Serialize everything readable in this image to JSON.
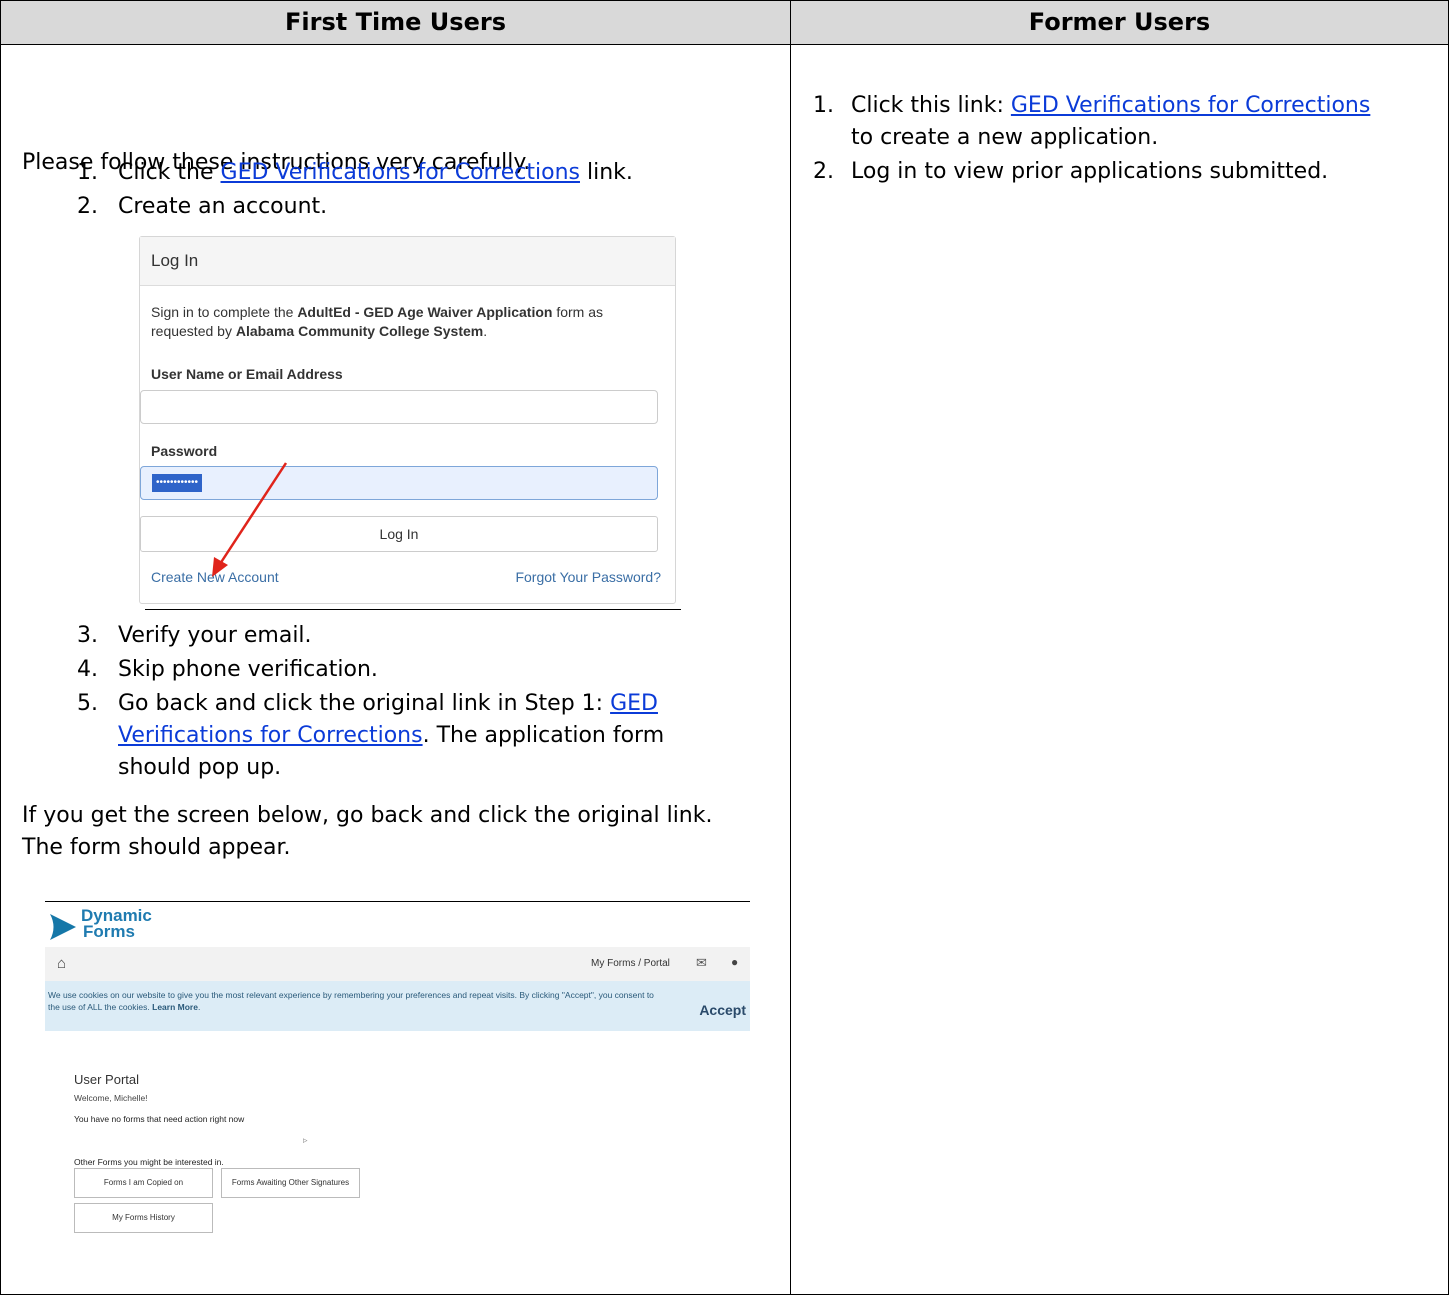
{
  "headers": {
    "left": "First Time Users",
    "right": "Former Users"
  },
  "left": {
    "intro": "Please follow these instructions very carefully.",
    "steps": {
      "s1_num": "1.",
      "s1_pre": "Click the ",
      "s1_link": "GED Verifications for Corrections",
      "s1_post": " link.",
      "s2_num": "2.",
      "s2": "Create an account.",
      "s3_num": "3.",
      "s3": "Verify your email.",
      "s4_num": "4.",
      "s4": "Skip phone verification.",
      "s5_num": "5.",
      "s5_pre": "Go back and click the original link in Step 1: ",
      "s5_link_a": "GED",
      "s5_link_b": "Verifications for Corrections",
      "s5_post_a": ". The application form",
      "s5_post_b": "should pop up."
    },
    "note_line1": "If you get the screen below, go back and click the original link.",
    "note_line2": "The form should appear."
  },
  "login_shot": {
    "title": "Log In",
    "desc_pre": "Sign in to complete the ",
    "desc_bold1": "AdultEd - GED Age Waiver Application",
    "desc_mid": " form as",
    "desc_line2_pre": "requested by ",
    "desc_bold2": "Alabama Community College System",
    "desc_line2_post": ".",
    "user_label": "User Name or Email Address",
    "password_label": "Password",
    "password_value": "••••••••••••",
    "login_button": "Log In",
    "create_account": "Create New Account",
    "forgot_password": "Forgot Your Password?"
  },
  "portal_shot": {
    "logo_line1": "Dynamic",
    "logo_line2": "Forms",
    "nav_link": "My Forms / Portal",
    "cookie_text_1": "We use cookies on our website to give you the most relevant experience by remembering your preferences and repeat visits. By clicking \"Accept\", you consent to",
    "cookie_text_2": "the use of ALL the cookies. ",
    "cookie_learn": "Learn More",
    "cookie_accept": "Accept",
    "portal_title": "User Portal",
    "welcome": "Welcome, Michelle!",
    "no_forms": "You have no forms that need action right now",
    "other_forms": "Other Forms you might be interested in.",
    "btn_copied": "Forms I am Copied on",
    "btn_awaiting": "Forms Awaiting Other Signatures",
    "btn_history": "My Forms History"
  },
  "right": {
    "r1_num": "1.",
    "r1_pre": "Click this link: ",
    "r1_link": "GED Verifications for Corrections",
    "r1_line2": "to create a new application.",
    "r2_num": "2.",
    "r2": "Log in to view prior applications submitted."
  },
  "colors": {
    "link": "#0b3bd8",
    "header_bg": "#d9d9d9",
    "arrow": "#e0241b",
    "cookie_bg": "#dcecf6"
  }
}
